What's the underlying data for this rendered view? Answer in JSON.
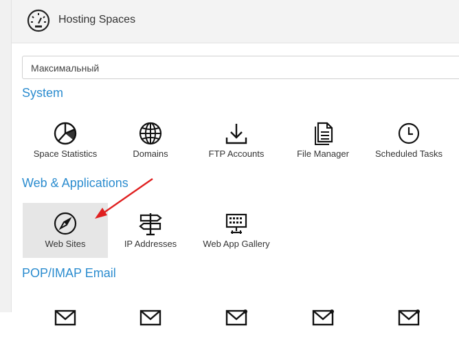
{
  "header": {
    "title": "Hosting Spaces",
    "icon": "dashboard-gauge-icon"
  },
  "plan_select": {
    "value": "Максимальный"
  },
  "sections": {
    "system": {
      "title": "System",
      "items": [
        {
          "label": "Space Statistics",
          "icon": "pie-chart-icon"
        },
        {
          "label": "Domains",
          "icon": "globe-icon"
        },
        {
          "label": "FTP Accounts",
          "icon": "download-icon"
        },
        {
          "label": "File Manager",
          "icon": "file-icon"
        },
        {
          "label": "Scheduled Tasks",
          "icon": "clock-icon"
        }
      ]
    },
    "web": {
      "title": "Web & Applications",
      "items": [
        {
          "label": "Web Sites",
          "icon": "compass-icon"
        },
        {
          "label": "IP Addresses",
          "icon": "signpost-icon"
        },
        {
          "label": "Web App Gallery",
          "icon": "monitor-keyboard-icon"
        }
      ]
    },
    "email": {
      "title": "POP/IMAP Email"
    }
  },
  "colors": {
    "section_title": "#2b8ccf",
    "selected_tile": "#e6e6e6",
    "annotation_arrow": "#e02020"
  }
}
